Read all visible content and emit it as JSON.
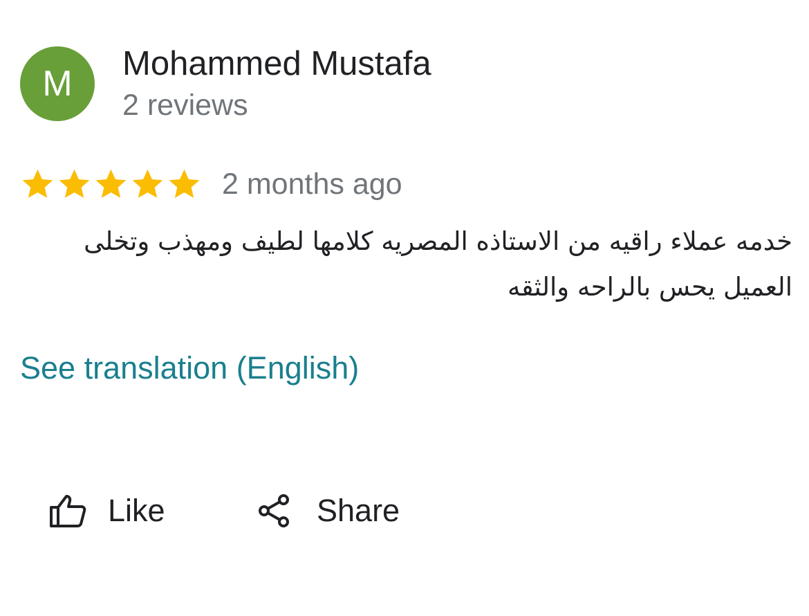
{
  "author": {
    "initial": "M",
    "name": "Mohammed Mustafa",
    "reviews": "2 reviews",
    "avatar_color": "#689f38"
  },
  "rating": {
    "stars": 5,
    "max": 5,
    "star_color": "#fbbc04",
    "time": "2 months ago"
  },
  "review": {
    "text": "خدمه عملاء راقيه من الاستاذه المصريه كلامها لطيف ومهذب وتخلى العميل يحس بالراحه والثقه"
  },
  "translate_link": {
    "label": "See translation (English)",
    "color": "#1a7f8e"
  },
  "actions": {
    "like": {
      "label": "Like",
      "icon": "thumb-up-icon"
    },
    "share": {
      "label": "Share",
      "icon": "share-icon"
    }
  }
}
